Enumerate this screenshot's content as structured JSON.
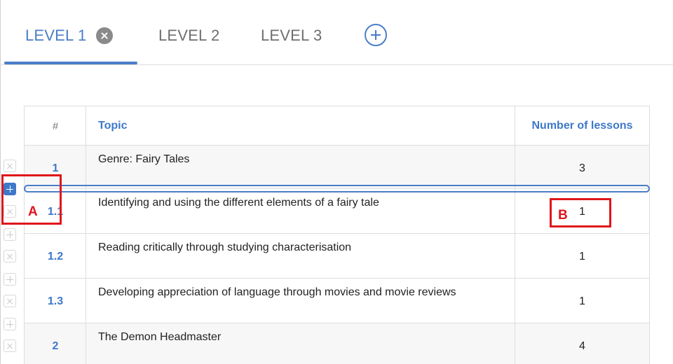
{
  "tabs": [
    {
      "label": "LEVEL 1",
      "active": true
    },
    {
      "label": "LEVEL 2",
      "active": false
    },
    {
      "label": "LEVEL 3",
      "active": false
    }
  ],
  "table": {
    "headers": {
      "num": "#",
      "topic": "Topic",
      "lessons": "Number of lessons"
    },
    "rows": [
      {
        "num": "1",
        "topic": "Genre: Fairy Tales",
        "lessons": "3",
        "parent": true
      },
      {
        "num": "1.1",
        "topic": "Identifying and using the different elements of a fairy tale",
        "lessons": "1",
        "parent": false
      },
      {
        "num": "1.2",
        "topic": "Reading critically through studying characterisation",
        "lessons": "1",
        "parent": false
      },
      {
        "num": "1.3",
        "topic": "Developing appreciation of language through movies and movie reviews",
        "lessons": "1",
        "parent": false
      },
      {
        "num": "2",
        "topic": "The Demon Headmaster",
        "lessons": "4",
        "parent": true
      }
    ]
  },
  "annotations": {
    "a": "A",
    "b": "B"
  },
  "colors": {
    "accent": "#4a7ec9",
    "annotation": "#e0161b"
  },
  "icons": [
    "close-icon",
    "add-icon",
    "plus-icon",
    "remove-icon"
  ]
}
